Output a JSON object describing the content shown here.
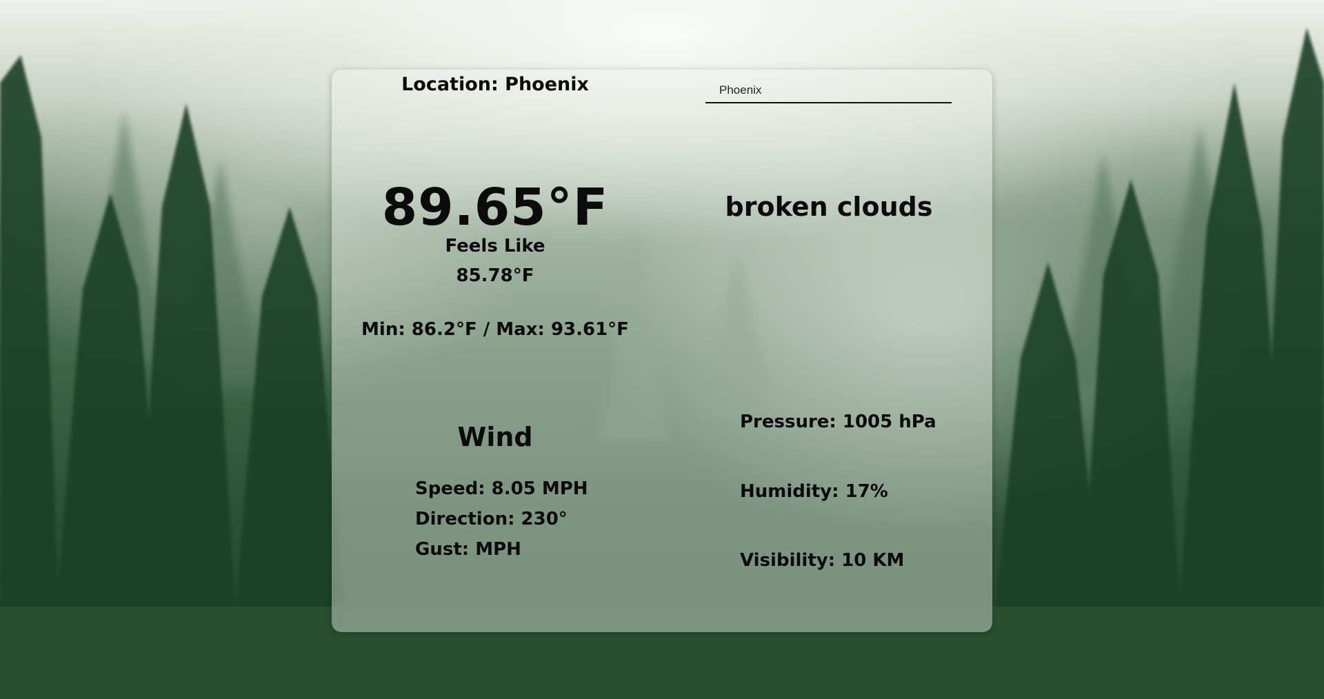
{
  "location": {
    "label": "Location: Phoenix"
  },
  "search": {
    "value": "Phoenix"
  },
  "current": {
    "temperature": "89.65°F",
    "feels_like_label": "Feels Like",
    "feels_like_value": "85.78°F",
    "min_max": "Min: 86.2°F / Max: 93.61°F",
    "description": "broken clouds"
  },
  "wind": {
    "title": "Wind",
    "speed": "Speed: 8.05 MPH",
    "direction": "Direction: 230°",
    "gust": "Gust: MPH"
  },
  "details": {
    "pressure": "Pressure: 1005 hPa",
    "humidity": "Humidity: 17%",
    "visibility": "Visibility: 10 KM"
  },
  "colors": {
    "forest_dark": "#213f28",
    "fog": "#eef1ec",
    "text": "#0b0b0b"
  }
}
